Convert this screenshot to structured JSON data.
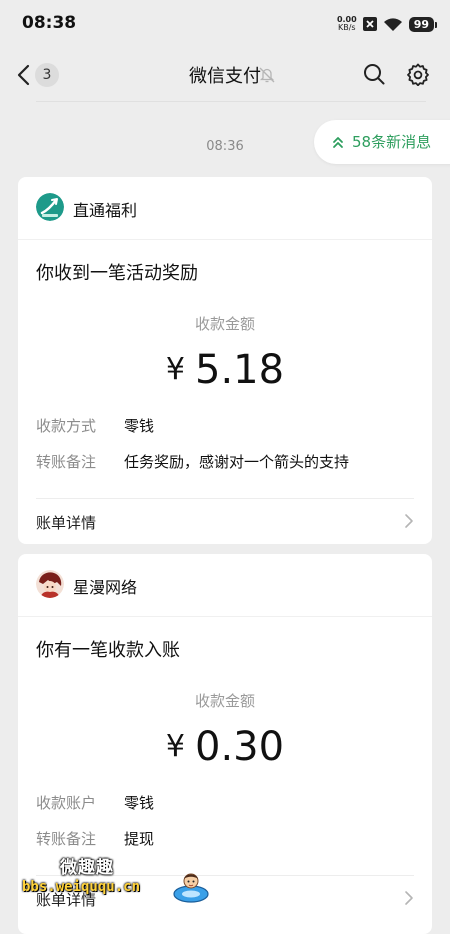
{
  "status_bar": {
    "time": "08:38",
    "net_speed_value": "0.00",
    "net_speed_unit": "KB/s",
    "battery": "99"
  },
  "nav": {
    "unread_count": "3",
    "title": "微信支付"
  },
  "new_messages": {
    "label": "58条新消息"
  },
  "timestamp": "08:36",
  "messages": [
    {
      "sender": "直通福利",
      "subtitle": "你收到一笔活动奖励",
      "amount_label": "收款金额",
      "currency": "¥",
      "amount": "5.18",
      "rows": [
        {
          "key": "收款方式",
          "value": "零钱"
        },
        {
          "key": "转账备注",
          "value": "任务奖励，感谢对一个箭头的支持"
        }
      ],
      "link": "账单详情"
    },
    {
      "sender": "星漫网络",
      "subtitle": "你有一笔收款入账",
      "amount_label": "收款金额",
      "currency": "¥",
      "amount": "0.30",
      "rows": [
        {
          "key": "收款账户",
          "value": "零钱"
        },
        {
          "key": "转账备注",
          "value": "提现"
        }
      ],
      "link": "账单详情"
    }
  ],
  "watermark": {
    "title": "微趣趣",
    "url": "bbs.weiququ.cn"
  },
  "colors": {
    "background": "#ededed",
    "card": "#ffffff",
    "accent_green": "#2e9e5e",
    "muted_text": "#8c8c8c"
  },
  "icons": [
    "back-icon",
    "mute-icon",
    "search-icon",
    "settings-icon",
    "double-chevron-up-icon",
    "chevron-right-icon",
    "wifi-icon",
    "signal-off-icon"
  ]
}
